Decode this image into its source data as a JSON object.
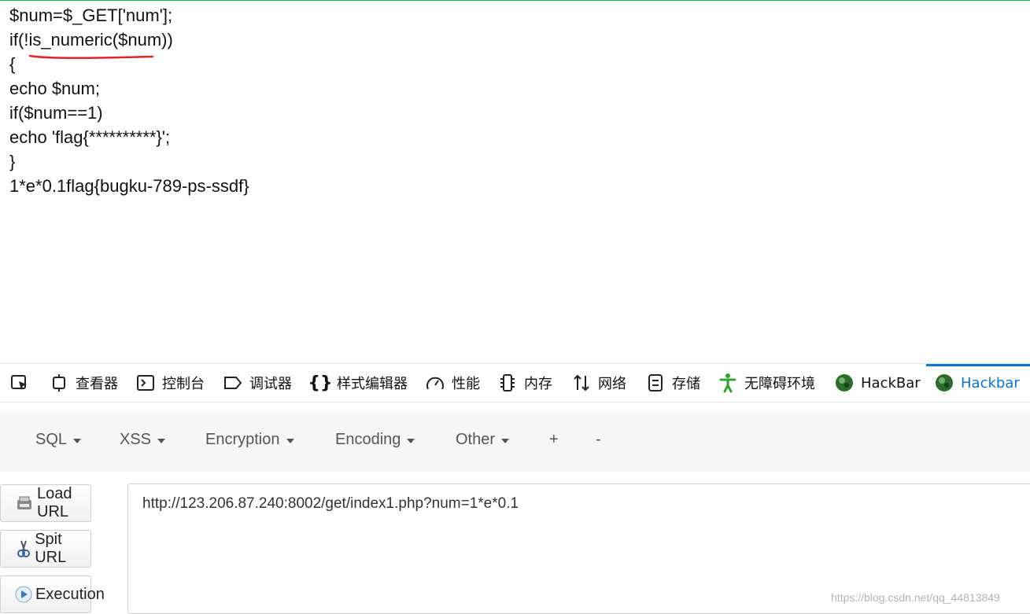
{
  "code_lines": [
    "$num=$_GET['num'];",
    "if(!is_numeric($num))",
    "{",
    "echo $num;",
    "if($num==1)",
    "echo 'flag{**********}';",
    "}",
    "1*e*0.1flag{bugku-789-ps-ssdf}"
  ],
  "devtools": {
    "tabs": [
      {
        "label": "查看器",
        "icon": "inspector-icon"
      },
      {
        "label": "控制台",
        "icon": "console-icon"
      },
      {
        "label": "调试器",
        "icon": "debugger-icon"
      },
      {
        "label": "样式编辑器",
        "icon": "style-editor-icon"
      },
      {
        "label": "性能",
        "icon": "performance-icon"
      },
      {
        "label": "内存",
        "icon": "memory-icon"
      },
      {
        "label": "网络",
        "icon": "network-icon"
      },
      {
        "label": "存储",
        "icon": "storage-icon"
      },
      {
        "label": "无障碍环境",
        "icon": "accessibility-icon"
      },
      {
        "label": "HackBar",
        "icon": "hackbar-icon"
      },
      {
        "label": "Hackbar",
        "icon": "hackbar-icon",
        "active": true
      }
    ],
    "active_color": "#0a74d8"
  },
  "hackbar": {
    "menu": [
      "SQL",
      "XSS",
      "Encryption",
      "Encoding",
      "Other",
      "+",
      "-"
    ],
    "buttons": {
      "load_url": "Load URL",
      "split_url": "Spit URL",
      "execution": "Execution"
    },
    "url": "http://123.206.87.240:8002/get/index1.php?num=1*e*0.1"
  },
  "watermark": "https://blog.csdn.net/qq_44813849",
  "annotation_color": "#e0242c"
}
